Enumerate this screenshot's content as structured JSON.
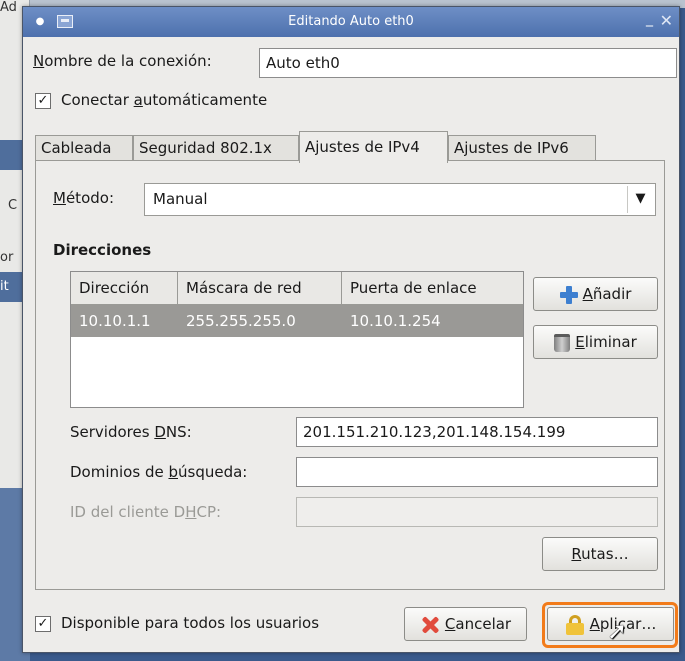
{
  "background": {
    "left_fragments": [
      "Ad",
      "C",
      "or",
      "it"
    ]
  },
  "window": {
    "title": "Editando Auto eth0",
    "min_glyph": "_",
    "close_glyph": "✕"
  },
  "connection": {
    "name_label_prefix": "N",
    "name_label_rest": "ombre de la conexión:",
    "name_value": "Auto eth0",
    "autoconnect_prefix": "Conectar ",
    "autoconnect_ul": "a",
    "autoconnect_rest": "utomáticamente",
    "autoconnect_checked": "✓"
  },
  "tabs": [
    {
      "label": "Cableada"
    },
    {
      "label": "Seguridad 802.1x"
    },
    {
      "label": "Ajustes de IPv4"
    },
    {
      "label": "Ajustes de IPv6"
    }
  ],
  "ipv4": {
    "method_label_ul": "M",
    "method_label_rest": "étodo:",
    "method_value": "Manual",
    "addresses_heading": "Direcciones",
    "table": {
      "columns": [
        "Dirección",
        "Máscara de red",
        "Puerta de enlace"
      ],
      "rows": [
        [
          "10.10.1.1",
          "255.255.255.0",
          "10.10.1.254"
        ]
      ]
    },
    "add_ul": "A",
    "add_rest": "ñadir",
    "delete_ul": "E",
    "delete_rest": "liminar",
    "dns_label_prefix": "Servidores ",
    "dns_label_ul": "D",
    "dns_label_rest": "NS:",
    "dns_value": "201.151.210.123,201.148.154.199",
    "search_label_prefix": "Dominios de ",
    "search_label_ul": "b",
    "search_label_rest": "úsqueda:",
    "search_value": "",
    "dhcp_label_prefix": "ID del cliente D",
    "dhcp_label_ul": "H",
    "dhcp_label_rest": "CP:",
    "dhcp_value": "",
    "routes_ul": "R",
    "routes_rest": "utas…"
  },
  "footer": {
    "all_users_label": "Disponible para todos los usuarios",
    "all_users_checked": "✓",
    "cancel_ul": "C",
    "cancel_rest": "ancelar",
    "apply_prefix": "A",
    "apply_rest": "plicar…"
  },
  "colors": {
    "highlight": "#f27b1a",
    "titlebar": "#5a7cb8",
    "selection": "#9a9996"
  }
}
